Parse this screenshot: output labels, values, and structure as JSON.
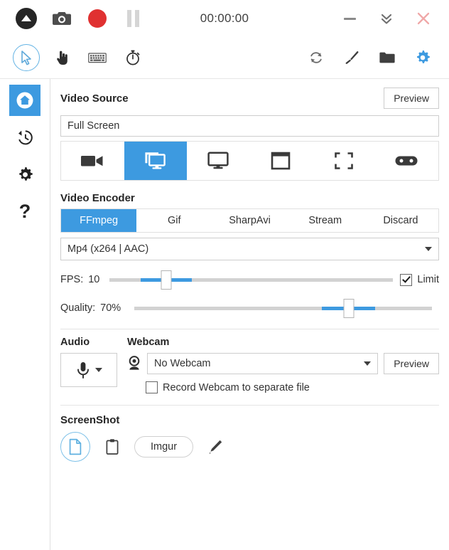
{
  "titlebar": {
    "logo_icon": "captura-logo-icon",
    "screenshot_icon": "camera-icon",
    "record_icon": "record-dot-icon",
    "pause_icon": "pause-icon",
    "timer": "00:00:00",
    "minimize_icon": "minimize-icon",
    "collapse_icon": "double-chevron-down-icon",
    "close_icon": "close-icon",
    "close_color": "#f0a8a8"
  },
  "toolbar": {
    "left": [
      {
        "name": "cursor-icon",
        "selected": true
      },
      {
        "name": "hand-click-icon",
        "selected": false
      },
      {
        "name": "keyboard-icon",
        "selected": false
      },
      {
        "name": "stopwatch-icon",
        "selected": false
      }
    ],
    "right": [
      {
        "name": "refresh-icon",
        "selected": false
      },
      {
        "name": "brush-icon",
        "selected": false
      },
      {
        "name": "folder-icon",
        "selected": false
      },
      {
        "name": "gear-icon",
        "selected": true
      }
    ]
  },
  "sidebar": {
    "items": [
      {
        "name": "sidebar-item-home",
        "icon": "home-icon",
        "active": true
      },
      {
        "name": "sidebar-item-history",
        "icon": "history-icon",
        "active": false
      },
      {
        "name": "sidebar-item-settings",
        "icon": "gear-icon",
        "active": false
      },
      {
        "name": "sidebar-item-help",
        "icon": "question-mark-icon",
        "active": false,
        "label": "?"
      }
    ]
  },
  "video_source": {
    "title": "Video Source",
    "preview_label": "Preview",
    "value": "Full Screen",
    "modes": [
      {
        "name": "source-mode-video-device",
        "icon": "video-camera-icon",
        "active": false
      },
      {
        "name": "source-mode-desktop-duplication",
        "icon": "multi-monitor-icon",
        "active": true
      },
      {
        "name": "source-mode-screen",
        "icon": "monitor-icon",
        "active": false
      },
      {
        "name": "source-mode-window",
        "icon": "window-icon",
        "active": false
      },
      {
        "name": "source-mode-region",
        "icon": "region-brackets-icon",
        "active": false
      },
      {
        "name": "source-mode-game",
        "icon": "gamepad-icon",
        "active": false
      }
    ]
  },
  "video_encoder": {
    "title": "Video Encoder",
    "tabs": [
      {
        "label": "FFmpeg",
        "active": true
      },
      {
        "label": "Gif",
        "active": false
      },
      {
        "label": "SharpAvi",
        "active": false
      },
      {
        "label": "Stream",
        "active": false
      },
      {
        "label": "Discard",
        "active": false
      }
    ],
    "format": "Mp4 (x264 | AAC)",
    "fps": {
      "label": "FPS:",
      "value": "10",
      "percent": 20,
      "limit_label": "Limit",
      "limit_checked": true
    },
    "quality": {
      "label": "Quality:",
      "value": "70%",
      "percent": 72
    }
  },
  "audio": {
    "title": "Audio",
    "mic_icon": "microphone-icon",
    "caret_icon": "chevron-down-icon"
  },
  "webcam": {
    "title": "Webcam",
    "icon": "webcam-icon",
    "value": "No Webcam",
    "preview_label": "Preview",
    "separate_file_label": "Record Webcam to separate file",
    "separate_file_checked": false
  },
  "screenshot": {
    "title": "ScreenShot",
    "targets": [
      {
        "name": "screenshot-target-disk",
        "icon": "file-document-icon",
        "active": true
      },
      {
        "name": "screenshot-target-clipboard",
        "icon": "clipboard-icon",
        "active": false
      }
    ],
    "imgur_label": "Imgur",
    "editor_icon": "pencil-icon"
  },
  "theme": {
    "accent": "#3d9ae0",
    "record_red": "#e03131",
    "text": "#333333"
  }
}
